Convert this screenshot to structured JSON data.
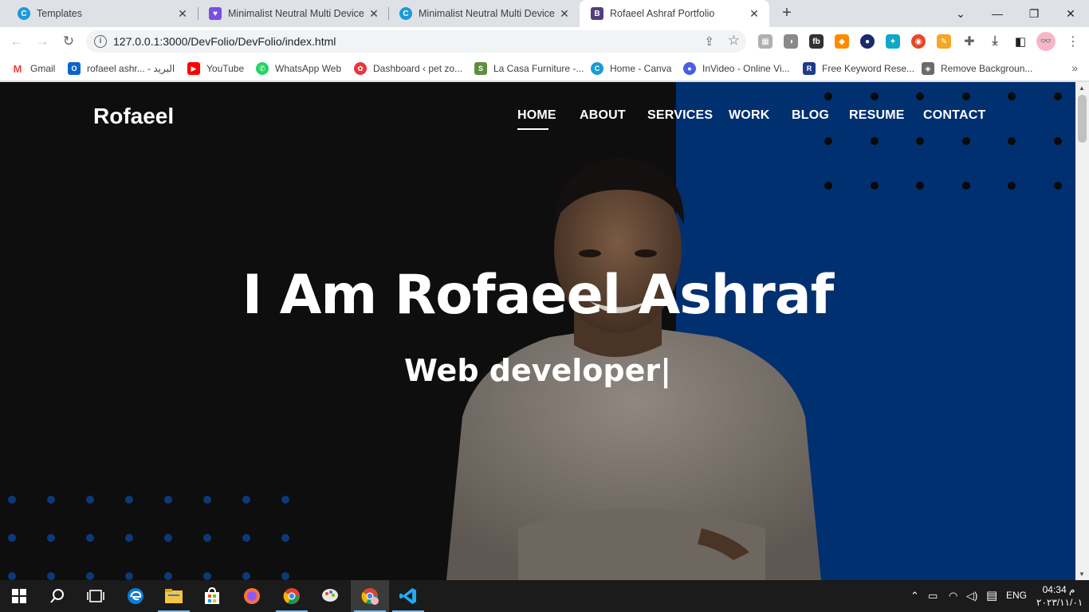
{
  "browser": {
    "tabs": [
      {
        "title": "Templates",
        "favicon": "canva-icon",
        "active": false
      },
      {
        "title": "Minimalist Neutral Multi Device",
        "favicon": "heart-shield-icon",
        "active": false
      },
      {
        "title": "Minimalist Neutral Multi Device",
        "favicon": "canva-icon",
        "active": false
      },
      {
        "title": "Rofaeel Ashraf Portfolio",
        "favicon": "bootstrap-icon",
        "active": true
      }
    ],
    "url": "127.0.0.1:3000/DevFolio/DevFolio/index.html",
    "bookmarks": [
      {
        "label": "Gmail",
        "icon": "gmail-icon",
        "color": "#ea4335"
      },
      {
        "label": "rofaeel ashr... - البريد",
        "icon": "outlook-icon",
        "color": "#0a64c8"
      },
      {
        "label": "YouTube",
        "icon": "youtube-icon",
        "color": "#ff0000"
      },
      {
        "label": "WhatsApp Web",
        "icon": "whatsapp-icon",
        "color": "#25d366"
      },
      {
        "label": "Dashboard ‹ pet zo...",
        "icon": "pet-icon",
        "color": "#e5383b"
      },
      {
        "label": "La Casa Furniture -...",
        "icon": "shopify-icon",
        "color": "#5e8e3e"
      },
      {
        "label": "Home - Canva",
        "icon": "canva-icon",
        "color": "#1a9bd7"
      },
      {
        "label": "InVideo - Online Vi...",
        "icon": "invideo-icon",
        "color": "#4a5de8"
      },
      {
        "label": "Free Keyword Rese...",
        "icon": "keyword-icon",
        "color": "#1d3c8c"
      },
      {
        "label": "Remove Backgroun...",
        "icon": "layers-icon",
        "color": "#6b6b6b"
      }
    ]
  },
  "site": {
    "logo": "Rofaeel",
    "nav": [
      "HOME",
      "ABOUT",
      "SERVICES",
      "WORK",
      "BLOG",
      "RESUME",
      "CONTACT"
    ],
    "hero_title": "I Am Rofaeel Ashraf",
    "hero_subtitle": "Web developer|",
    "colors": {
      "accent": "#003070",
      "background": "#0e0e0e",
      "text": "#ffffff"
    }
  },
  "taskbar": {
    "language": "ENG",
    "time": "04:34 م",
    "date": "٢٠٢٣/١١/٠١"
  }
}
